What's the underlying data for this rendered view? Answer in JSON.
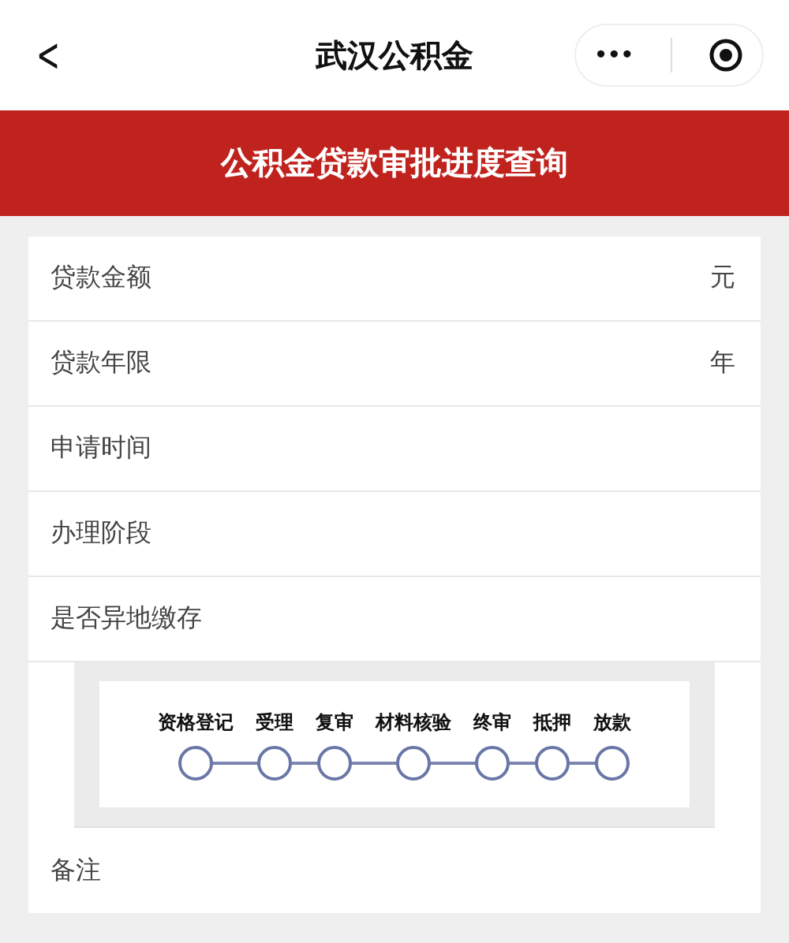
{
  "nav": {
    "back": "<",
    "title": "武汉公积金",
    "more": "•••"
  },
  "banner": {
    "title": "公积金贷款审批进度查询"
  },
  "fields": [
    {
      "label": "贷款金额",
      "unit": "元"
    },
    {
      "label": "贷款年限",
      "unit": "年"
    },
    {
      "label": "申请时间"
    },
    {
      "label": "办理阶段"
    },
    {
      "label": "是否异地缴存"
    }
  ],
  "progress": [
    "资格登记",
    "受理",
    "复审",
    "材料核验",
    "终审",
    "抵押",
    "放款"
  ],
  "remark": {
    "label": "备注"
  }
}
